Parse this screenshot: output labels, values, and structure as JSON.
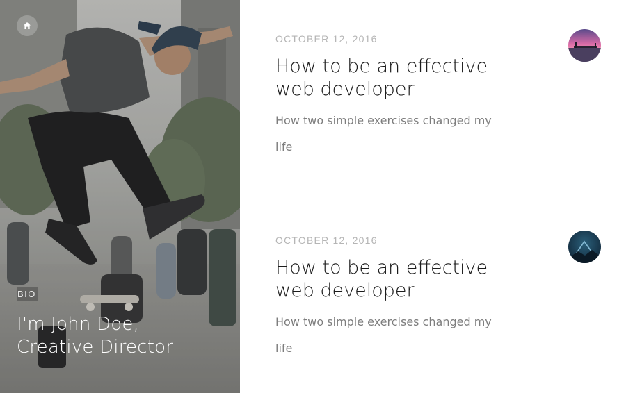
{
  "hero": {
    "home_icon": "home-icon",
    "bio_label": "BIO",
    "name_line1": "I'm John Doe,",
    "name_line2": "Creative Director"
  },
  "posts": [
    {
      "date": "OCTOBER 12, 2016",
      "title_line1": "How to be an effective",
      "title_line2": "web developer",
      "summary_line1": "How two simple exercises changed my",
      "summary_line2": "life",
      "avatar": "sunset-pier-thumbnail"
    },
    {
      "date": "OCTOBER 12, 2016",
      "title_line1": "How to be an effective",
      "title_line2": "web developer",
      "summary_line1": "How two simple exercises changed my",
      "summary_line2": "life",
      "avatar": "mountain-triangle-thumbnail"
    }
  ],
  "colors": {
    "title": "#1c1c1c",
    "date": "#b5b5b5",
    "summary": "#7d7d7d",
    "divider": "#ececec"
  }
}
